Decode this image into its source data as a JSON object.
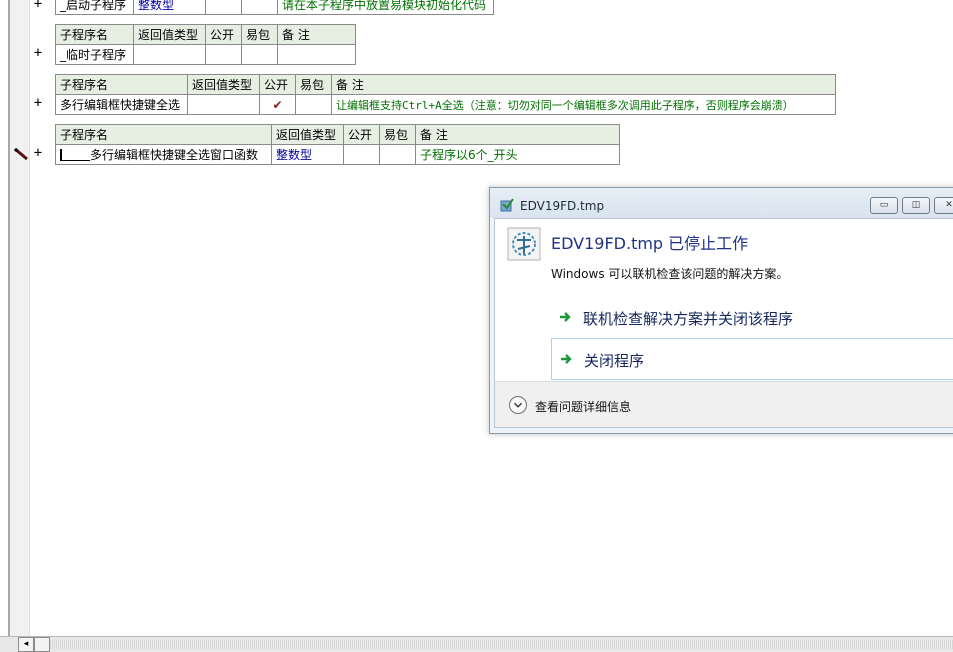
{
  "gutter": {
    "marker_symbol": "+"
  },
  "tables": [
    {
      "header": null,
      "rows": [
        [
          "_启动子程序",
          "整数型",
          "",
          "",
          "请在本子程序中放置易模块初始化代码"
        ]
      ]
    },
    {
      "header": [
        "子程序名",
        "返回值类型",
        "公开",
        "易包",
        "备 注"
      ],
      "rows": [
        [
          "_临时子程序",
          "",
          "",
          "",
          ""
        ]
      ]
    },
    {
      "header": [
        "子程序名",
        "返回值类型",
        "公开",
        "易包",
        "备 注"
      ],
      "rows": [
        [
          "多行编辑框快捷键全选",
          "",
          "✔",
          "",
          "让编辑框支持Ctrl+A全选（注意：切勿对同一个编辑框多次调用此子程序，否则程序会崩溃）"
        ]
      ]
    },
    {
      "header": [
        "子程序名",
        "返回值类型",
        "公开",
        "易包",
        "备 注"
      ],
      "rows": [
        [
          "多行编辑框快捷键全选窗口函数",
          "整数型",
          "",
          "",
          "子程序以6个_开头"
        ]
      ]
    }
  ],
  "dialog": {
    "title": "EDV19FD.tmp",
    "heading": "EDV19FD.tmp 已停止工作",
    "message": "Windows 可以联机检查该问题的解决方案。",
    "option_online": "联机检查解决方案并关闭该程序",
    "option_close": "关闭程序",
    "details": "查看问题详细信息",
    "minimize": "▭",
    "maximize": "◫",
    "close": "✕"
  },
  "scrollbar": {
    "left_arrow": "◂"
  },
  "colors": {
    "header_bg": "#e7efe3",
    "comment_green": "#007000",
    "type_blue": "#0000a0",
    "check_red": "#8b1a1a",
    "dialog_heading": "#1e3287"
  }
}
